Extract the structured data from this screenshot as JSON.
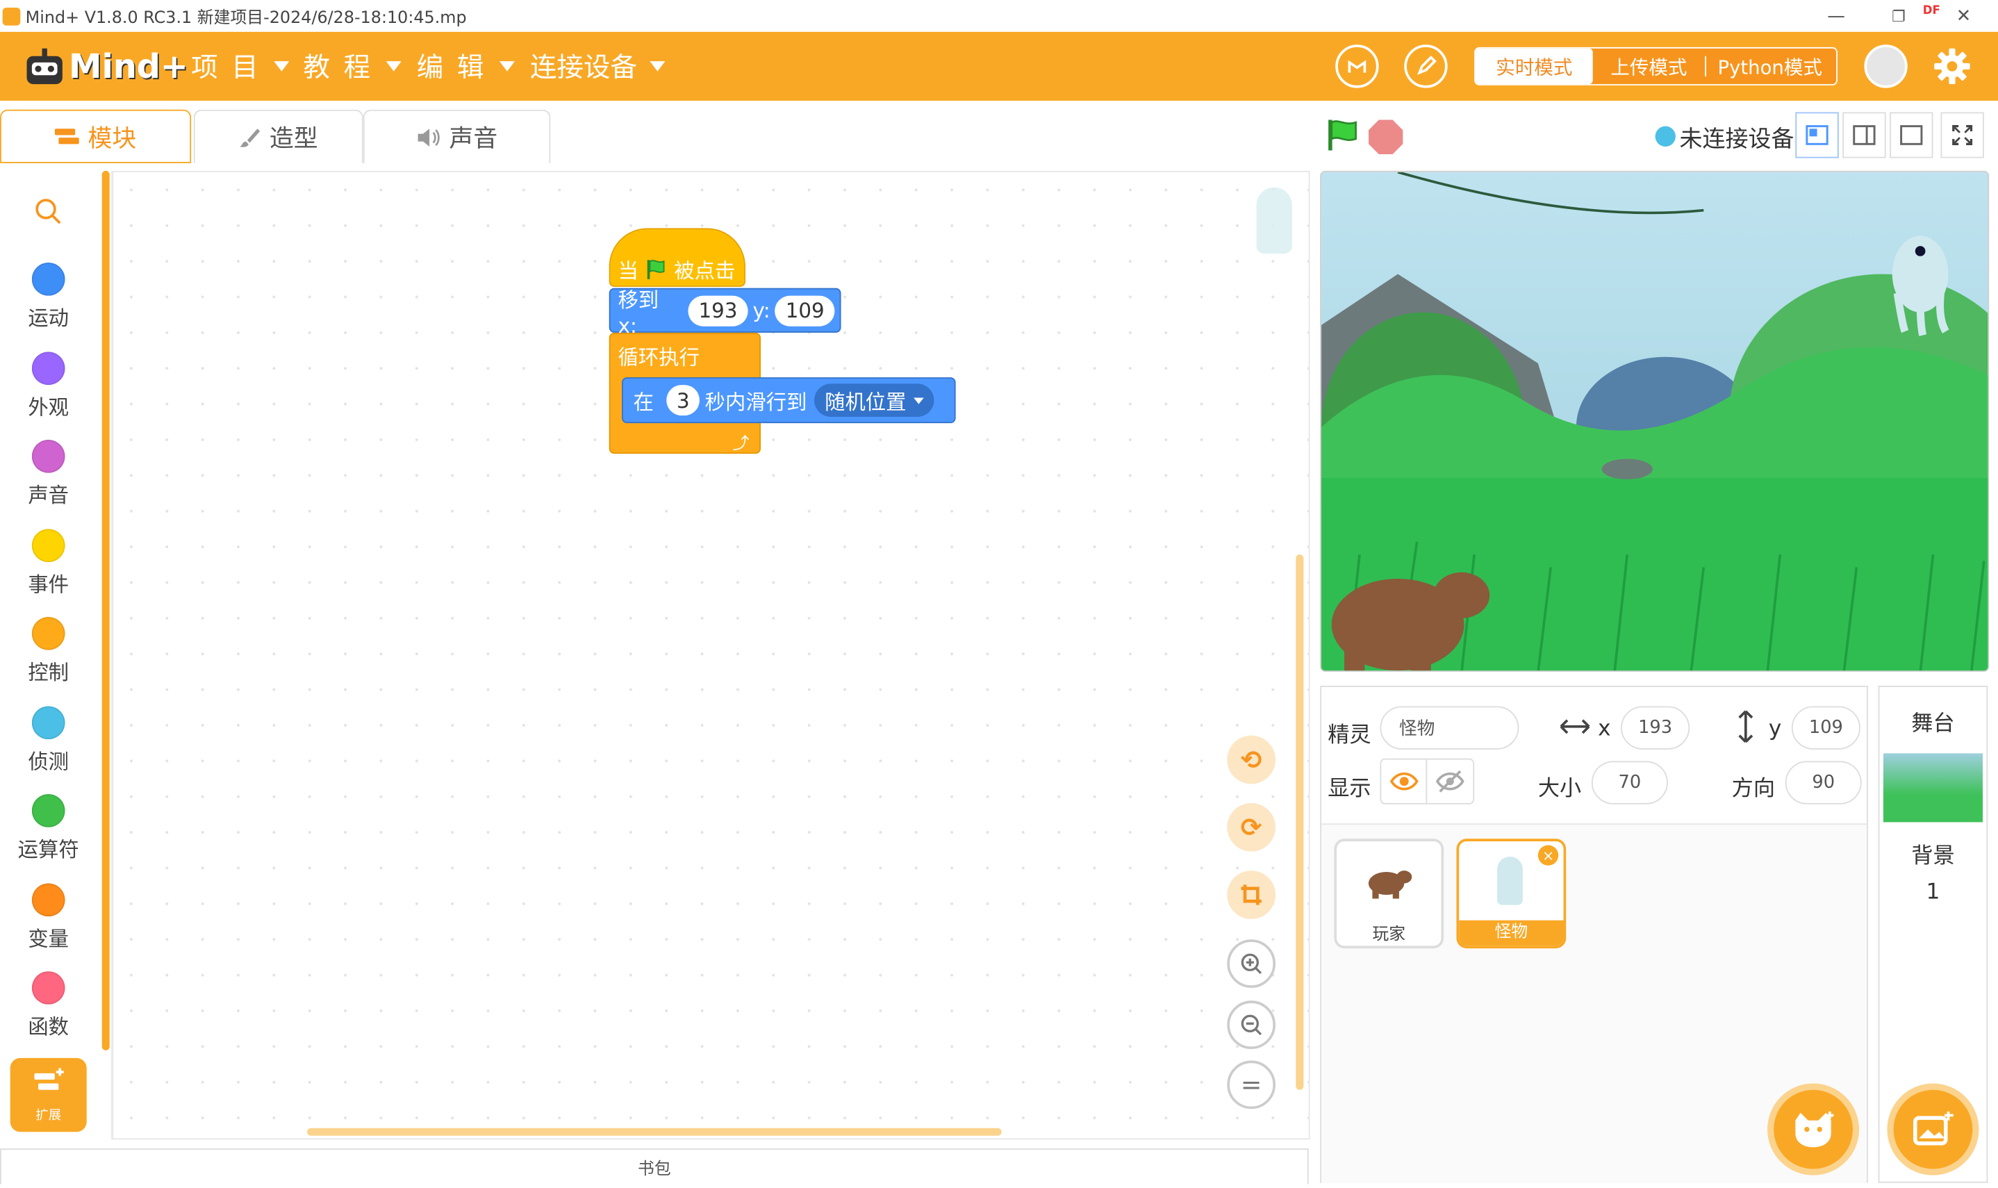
{
  "titlebar": {
    "title": "Mind+ V1.8.0 RC3.1   新建项目-2024/6/28-18:10:45.mp",
    "df_label": "DF",
    "minimize": "—",
    "restore": "❐",
    "close": "✕"
  },
  "menubar": {
    "logo": "Mind+",
    "items": [
      "项 目",
      "教 程",
      "编 辑",
      "连接设备"
    ],
    "modes": [
      "实时模式",
      "上传模式",
      "Python模式"
    ],
    "active_mode": "实时模式"
  },
  "tabs": [
    {
      "label": "模块",
      "icon": "blocks-icon"
    },
    {
      "label": "造型",
      "icon": "brush-icon"
    },
    {
      "label": "声音",
      "icon": "speaker-icon"
    }
  ],
  "categories": [
    {
      "label": "运动",
      "color": "#3e8ef7"
    },
    {
      "label": "外观",
      "color": "#9966ff"
    },
    {
      "label": "声音",
      "color": "#cf63cf"
    },
    {
      "label": "事件",
      "color": "#ffd500"
    },
    {
      "label": "控制",
      "color": "#ffab19"
    },
    {
      "label": "侦测",
      "color": "#4cbfe6"
    },
    {
      "label": "运算符",
      "color": "#40bf4a"
    },
    {
      "label": "变量",
      "color": "#ff8c1a"
    },
    {
      "label": "函数",
      "color": "#ff6680"
    }
  ],
  "extensions_label": "扩展",
  "script": {
    "hat": {
      "prefix": "当",
      "suffix": "被点击"
    },
    "goto": {
      "label": "移到 x:",
      "x": "193",
      "ylabel": "y:",
      "y": "109"
    },
    "forever": {
      "label": "循环执行"
    },
    "glide": {
      "prefix": "在",
      "secs": "3",
      "middle": "秒内滑行到",
      "target": "随机位置"
    }
  },
  "backpack_label": "书包",
  "stage_header": {
    "connection": "未连接设备"
  },
  "sprite_info": {
    "sprite_label": "精灵",
    "sprite_name": "怪物",
    "x_label": "x",
    "x": "193",
    "y_label": "y",
    "y": "109",
    "show_label": "显示",
    "size_label": "大小",
    "size": "70",
    "direction_label": "方向",
    "direction": "90"
  },
  "sprites": [
    {
      "name": "玩家",
      "selected": false
    },
    {
      "name": "怪物",
      "selected": true
    }
  ],
  "stage_panel": {
    "title": "舞台",
    "backdrop_label": "背景",
    "backdrop_count": "1"
  },
  "colors": {
    "accent": "#f9a826",
    "motion": "#4c97ff",
    "control": "#ffab19"
  }
}
